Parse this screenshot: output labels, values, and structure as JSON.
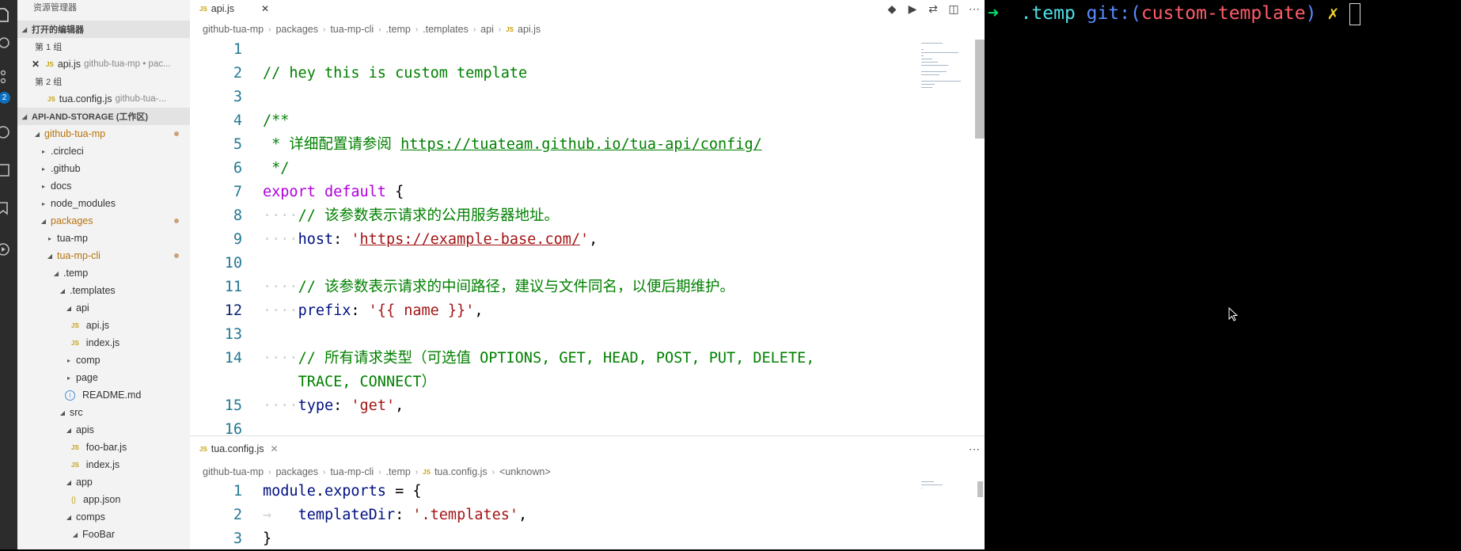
{
  "sidebar": {
    "title": "资源管理器",
    "open_editors_header": "打开的编辑器",
    "group1": "第 1 组",
    "group1_file": {
      "name": "api.js",
      "path": "github-tua-mp • pac..."
    },
    "group2": "第 2 组",
    "group2_file": {
      "name": "tua.config.js",
      "path": "github-tua-..."
    },
    "workspace_header": "API-AND-STORAGE (工作区)",
    "tree": [
      {
        "label": "github-tua-mp",
        "level": 0,
        "type": "folder-open",
        "modified": true
      },
      {
        "label": ".circleci",
        "level": 1,
        "type": "folder"
      },
      {
        "label": ".github",
        "level": 1,
        "type": "folder"
      },
      {
        "label": "docs",
        "level": 1,
        "type": "folder"
      },
      {
        "label": "node_modules",
        "level": 1,
        "type": "folder"
      },
      {
        "label": "packages",
        "level": 1,
        "type": "folder-open",
        "modified": true
      },
      {
        "label": "tua-mp",
        "level": 2,
        "type": "folder"
      },
      {
        "label": "tua-mp-cli",
        "level": 2,
        "type": "folder-open",
        "modified": true
      },
      {
        "label": ".temp",
        "level": 3,
        "type": "folder-open"
      },
      {
        "label": ".templates",
        "level": 4,
        "type": "folder-open"
      },
      {
        "label": "api",
        "level": 5,
        "type": "folder-open"
      },
      {
        "label": "api.js",
        "level": 6,
        "type": "js"
      },
      {
        "label": "index.js",
        "level": 6,
        "type": "js"
      },
      {
        "label": "comp",
        "level": 5,
        "type": "folder"
      },
      {
        "label": "page",
        "level": 5,
        "type": "folder"
      },
      {
        "label": "README.md",
        "level": 5,
        "type": "info"
      },
      {
        "label": "src",
        "level": 4,
        "type": "folder-open"
      },
      {
        "label": "apis",
        "level": 5,
        "type": "folder-open"
      },
      {
        "label": "foo-bar.js",
        "level": 6,
        "type": "js"
      },
      {
        "label": "index.js",
        "level": 6,
        "type": "js"
      },
      {
        "label": "app",
        "level": 5,
        "type": "folder-open"
      },
      {
        "label": "app.json",
        "level": 6,
        "type": "json"
      },
      {
        "label": "comps",
        "level": 5,
        "type": "folder-open"
      },
      {
        "label": "FooBar",
        "level": 6,
        "type": "folder-open"
      }
    ]
  },
  "editor_top": {
    "tab": "api.js",
    "breadcrumbs": [
      "github-tua-mp",
      "packages",
      "tua-mp-cli",
      ".temp",
      ".templates",
      "api",
      "api.js"
    ],
    "lines": [
      {
        "n": "1",
        "parts": []
      },
      {
        "n": "2",
        "parts": [
          {
            "t": "// hey this is custom template",
            "c": "c"
          }
        ]
      },
      {
        "n": "3",
        "parts": []
      },
      {
        "n": "4",
        "parts": [
          {
            "t": "/**",
            "c": "c"
          }
        ]
      },
      {
        "n": "5",
        "parts": [
          {
            "t": " * 详细配置请参阅 ",
            "c": "c"
          },
          {
            "t": "https://tuateam.github.io/tua-api/config/",
            "c": "c u"
          }
        ]
      },
      {
        "n": "6",
        "parts": [
          {
            "t": " */",
            "c": "c"
          }
        ]
      },
      {
        "n": "7",
        "parts": [
          {
            "t": "export default",
            "c": "k"
          },
          {
            "t": " {",
            "c": ""
          }
        ]
      },
      {
        "n": "8",
        "parts": [
          {
            "t": "····",
            "c": "ws"
          },
          {
            "t": "// 该参数表示请求的公用服务器地址。",
            "c": "c"
          }
        ]
      },
      {
        "n": "9",
        "parts": [
          {
            "t": "····",
            "c": "ws"
          },
          {
            "t": "host",
            "c": "p"
          },
          {
            "t": ": ",
            "c": ""
          },
          {
            "t": "'",
            "c": "s"
          },
          {
            "t": "https://example-base.com/",
            "c": "s u"
          },
          {
            "t": "'",
            "c": "s"
          },
          {
            "t": ",",
            "c": ""
          }
        ]
      },
      {
        "n": "10",
        "parts": []
      },
      {
        "n": "11",
        "parts": [
          {
            "t": "····",
            "c": "ws"
          },
          {
            "t": "// 该参数表示请求的中间路径，建议与文件同名，以便后期维护。",
            "c": "c"
          }
        ]
      },
      {
        "n": "12",
        "parts": [
          {
            "t": "····",
            "c": "ws"
          },
          {
            "t": "prefix",
            "c": "p"
          },
          {
            "t": ": ",
            "c": ""
          },
          {
            "t": "'{{ name }}'",
            "c": "s"
          },
          {
            "t": ",",
            "c": ""
          }
        ],
        "active": true
      },
      {
        "n": "13",
        "parts": []
      },
      {
        "n": "14",
        "parts": [
          {
            "t": "····",
            "c": "ws"
          },
          {
            "t": "// 所有请求类型（可选值 OPTIONS, GET, HEAD, POST, PUT, DELETE,",
            "c": "c"
          }
        ]
      },
      {
        "n": "",
        "parts": [
          {
            "t": "    ",
            "c": ""
          },
          {
            "t": "TRACE, CONNECT）",
            "c": "c"
          }
        ]
      },
      {
        "n": "15",
        "parts": [
          {
            "t": "····",
            "c": "ws"
          },
          {
            "t": "type",
            "c": "p"
          },
          {
            "t": ": ",
            "c": ""
          },
          {
            "t": "'get'",
            "c": "s"
          },
          {
            "t": ",",
            "c": ""
          }
        ]
      },
      {
        "n": "16",
        "parts": []
      }
    ]
  },
  "editor_bottom": {
    "tab": "tua.config.js",
    "breadcrumbs": [
      "github-tua-mp",
      "packages",
      "tua-mp-cli",
      ".temp",
      "tua.config.js",
      "<unknown>"
    ],
    "lines": [
      {
        "n": "1",
        "parts": [
          {
            "t": "module",
            "c": "p"
          },
          {
            "t": ".",
            "c": ""
          },
          {
            "t": "exports",
            "c": "p"
          },
          {
            "t": " = {",
            "c": ""
          }
        ]
      },
      {
        "n": "2",
        "parts": [
          {
            "t": "→   ",
            "c": "ws"
          },
          {
            "t": "templateDir",
            "c": "p"
          },
          {
            "t": ": ",
            "c": ""
          },
          {
            "t": "'.templates'",
            "c": "s"
          },
          {
            "t": ",",
            "c": ""
          }
        ]
      },
      {
        "n": "3",
        "parts": [
          {
            "t": "}",
            "c": ""
          }
        ]
      }
    ]
  },
  "terminal": {
    "arrow": "➜",
    "dir": ".temp",
    "git": "git:(",
    "branch": "custom-template",
    "git_close": ")",
    "dirty": "✗"
  },
  "colors": {
    "comment": "#008000",
    "keyword": "#af00db",
    "string": "#a31515",
    "property": "#001080",
    "line_number": "#237893",
    "terminal_bg": "#000000"
  }
}
